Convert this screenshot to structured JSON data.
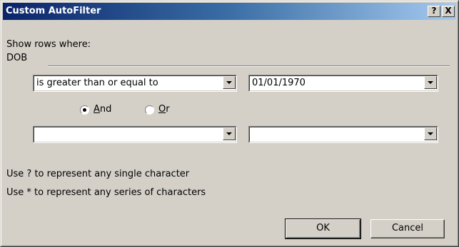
{
  "window": {
    "title": "Custom AutoFilter",
    "help_glyph": "?",
    "close_glyph": "X"
  },
  "show_rows_label": "Show rows where:",
  "field_name": "DOB",
  "criteria1": {
    "operator": "is greater than or equal to",
    "value": "01/01/1970"
  },
  "logic": {
    "and_label": "And",
    "and_accel": "A",
    "and_rest": "nd",
    "or_label": "Or",
    "or_accel": "O",
    "or_rest": "r",
    "selected": "And"
  },
  "criteria2": {
    "operator": "",
    "value": ""
  },
  "hints": {
    "single_char": "Use ? to represent any single character",
    "series_chars": "Use * to represent any series of characters"
  },
  "buttons": {
    "ok": "OK",
    "cancel": "Cancel"
  },
  "colors": {
    "face": "#d4d0c8",
    "title_start": "#0a246a",
    "title_end": "#a6caf0"
  }
}
